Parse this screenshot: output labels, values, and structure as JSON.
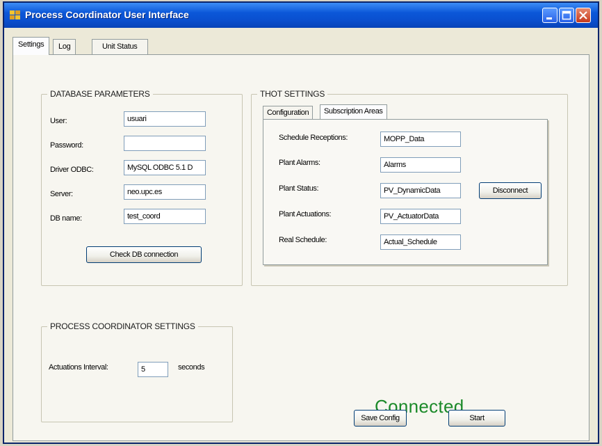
{
  "window": {
    "title": "Process Coordinator User Interface"
  },
  "tabs": [
    {
      "label": "Settings",
      "active": true
    },
    {
      "label": "Log",
      "active": false
    },
    {
      "label": "Unit Status",
      "active": false
    }
  ],
  "database": {
    "legend": "DATABASE PARAMETERS",
    "user_label": "User:",
    "user_value": "usuari",
    "password_label": "Password:",
    "password_value": "",
    "driver_label": "Driver ODBC:",
    "driver_value": "MySQL ODBC 5.1 D",
    "server_label": "Server:",
    "server_value": "neo.upc.es",
    "dbname_label": "DB name:",
    "dbname_value": "test_coord",
    "check_button": "Check DB connection"
  },
  "thot": {
    "legend": "THOT SETTINGS",
    "subtabs": [
      {
        "label": "Configuration",
        "active": false
      },
      {
        "label": "Subscription Areas",
        "active": true
      }
    ],
    "schedule_label": "Schedule Receptions:",
    "schedule_value": "MOPP_Data",
    "alarms_label": "Plant Alarms:",
    "alarms_value": "Alarms",
    "status_label": "Plant Status:",
    "status_value": "PV_DynamicData",
    "actuations_label": "Plant Actuations:",
    "actuations_value": "PV_ActuatorData",
    "real_label": "Real Schedule:",
    "real_value": "Actual_Schedule",
    "disconnect_button": "Disconnect"
  },
  "pc": {
    "legend": "PROCESS COORDINATOR SETTINGS",
    "interval_label": "Actuations Interval:",
    "interval_value": "5",
    "unit": "seconds"
  },
  "connection_status": "Connected",
  "buttons": {
    "save": "Save Config",
    "start": "Start"
  },
  "colors": {
    "titlebar": "#0b57d8",
    "status_text": "#1c8a2a"
  }
}
